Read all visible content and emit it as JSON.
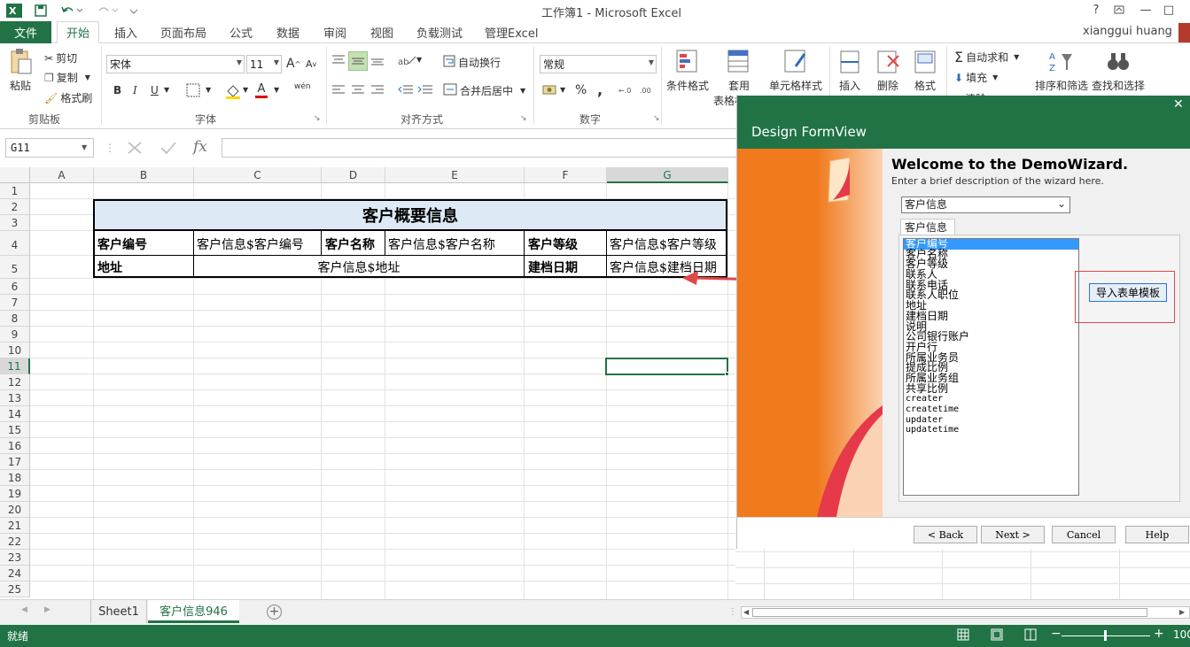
{
  "window": {
    "title": "工作簿1 - Microsoft Excel",
    "user": "xianggui huang",
    "help": "?",
    "min": "—",
    "max": "□",
    "close": "✕"
  },
  "tabs": {
    "file": "文件",
    "items": [
      "开始",
      "插入",
      "页面布局",
      "公式",
      "数据",
      "审阅",
      "视图",
      "负载测试",
      "管理Excel"
    ]
  },
  "ribbon": {
    "clipboard": {
      "paste": "粘贴",
      "cut": "剪切",
      "copy": "复制",
      "format_painter": "格式刷",
      "label": "剪贴板"
    },
    "font": {
      "name": "宋体",
      "size": "11",
      "bold": "B",
      "italic": "I",
      "underline": "U",
      "grow": "A",
      "shrink": "A",
      "font_color": "A",
      "phonetic": "wén",
      "label": "字体"
    },
    "align": {
      "wrap": "自动换行",
      "merge": "合并后居中",
      "label": "对齐方式"
    },
    "number": {
      "format": "常规",
      "percent": "%",
      "comma": ",",
      "label": "数字"
    },
    "styles": {
      "conditional": "条件格式",
      "table": "套用",
      "table2": "表格格",
      "cell_styles": "单元格样式"
    },
    "cells": {
      "insert": "插入",
      "delete": "删除",
      "format": "格式"
    },
    "editing": {
      "autosum": "自动求和",
      "fill": "填充",
      "clear": "清除",
      "sort": "排序和筛选",
      "find": "查找和选择"
    }
  },
  "formula_bar": {
    "namebox": "G11",
    "fx": "fx",
    "value": ""
  },
  "grid": {
    "columns": [
      "A",
      "B",
      "C",
      "D",
      "E",
      "F",
      "G"
    ],
    "rows": [
      "1",
      "2",
      "3",
      "4",
      "5",
      "6",
      "7",
      "8",
      "9",
      "10",
      "11",
      "12",
      "13",
      "14",
      "15",
      "16",
      "17",
      "18",
      "19",
      "20",
      "21",
      "22",
      "23",
      "24",
      "25"
    ],
    "title": "客户概要信息",
    "r4": [
      "客户编号",
      "客户信息$客户编号",
      "客户名称",
      "客户信息$客户名称",
      "客户等级",
      "客户信息$客户等级"
    ],
    "r5": [
      "地址",
      "客户信息$地址",
      "建档日期",
      "客户信息$建档日期"
    ]
  },
  "sheets": {
    "tabs": [
      "Sheet1",
      "客户信息946"
    ],
    "active": 1,
    "add": "+"
  },
  "status": {
    "ready": "就绪",
    "zoom": "100"
  },
  "dialog": {
    "close": "✕",
    "title": "Design FormView",
    "welcome": "Welcome to the DemoWizard.",
    "description": "Enter a brief description of the wizard here.",
    "select_value": "客户信息",
    "tab": "客户信息",
    "fields": [
      "客户编号",
      "客户名称",
      "客户等级",
      "联系人",
      "联系电话",
      "联系人职位",
      "地址",
      "建档日期",
      "说明",
      "公司银行账户",
      "开户行",
      "所属业务员",
      "提成比例",
      "所属业务组",
      "共享比例",
      "creater",
      "createtime",
      "updater",
      "updatetime"
    ],
    "selected_field": 0,
    "import_button": "导入表单模板",
    "buttons": {
      "back": "< Back",
      "next": "Next >",
      "cancel": "Cancel",
      "help": "Help"
    }
  },
  "colors": {
    "excel_green": "#217346",
    "annotation_red": "#e04747",
    "header_fill": "#dde9f5",
    "orange": "#f07a1c"
  }
}
